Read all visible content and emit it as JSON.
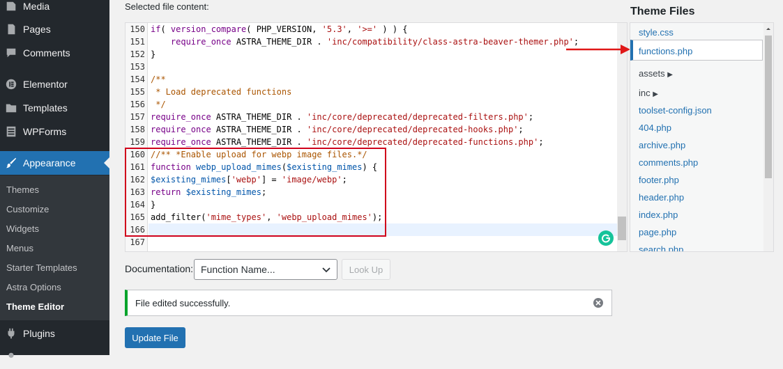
{
  "sidebar": {
    "items": [
      {
        "label": "Media",
        "icon": "media-icon"
      },
      {
        "label": "Pages",
        "icon": "pages-icon"
      },
      {
        "label": "Comments",
        "icon": "comments-icon"
      },
      {
        "label": "Elementor",
        "icon": "elementor-icon"
      },
      {
        "label": "Templates",
        "icon": "folder-icon"
      },
      {
        "label": "WPForms",
        "icon": "forms-icon"
      },
      {
        "label": "Appearance",
        "icon": "paintbrush-icon"
      },
      {
        "label": "Plugins",
        "icon": "plugin-icon"
      }
    ],
    "submenu": [
      "Themes",
      "Customize",
      "Widgets",
      "Menus",
      "Starter Templates",
      "Astra Options",
      "Theme Editor"
    ],
    "current_submenu": "Theme Editor"
  },
  "editor": {
    "label": "Selected file content:",
    "line_numbers": [
      "150",
      "151",
      "152",
      "153",
      "154",
      "155",
      "156",
      "157",
      "158",
      "159",
      "160",
      "161",
      "162",
      "163",
      "164",
      "165",
      "166",
      "167"
    ]
  },
  "documentation": {
    "label": "Documentation:",
    "select_value": "Function Name...",
    "lookup_label": "Look Up"
  },
  "notice": {
    "text": "File edited successfully."
  },
  "update_button": "Update File",
  "theme_files": {
    "title": "Theme Files",
    "items": [
      "style.css",
      "functions.php",
      "assets",
      "inc",
      "toolset-config.json",
      "404.php",
      "archive.php",
      "comments.php",
      "footer.php",
      "header.php",
      "index.php",
      "page.php",
      "search.php"
    ],
    "active": "functions.php"
  },
  "colors": {
    "sidebar_bg": "#23282d",
    "accent": "#2271b1",
    "success": "#00a32a",
    "highlight_box": "#d0021b"
  }
}
